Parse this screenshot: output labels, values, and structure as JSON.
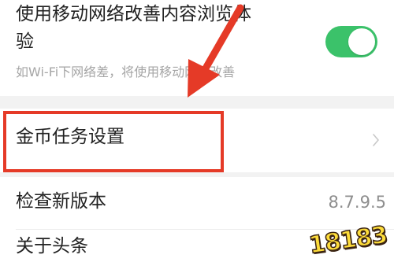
{
  "settings": {
    "mobile_improve": {
      "title_line1": "使用移动网络改善内容浏览体",
      "title_line2": "验",
      "subtitle": "如Wi-Fi下网络差，将使用移动网络改善",
      "toggle_on": true,
      "toggle_color": "#3bc26a"
    },
    "coin_task": {
      "label": "金币任务设置"
    },
    "check_update": {
      "label": "检查新版本",
      "version": "8.7.9.5"
    },
    "about": {
      "label": "关于头条"
    }
  },
  "annotation": {
    "highlight_color": "#e53a27",
    "arrow_color": "#e53a27"
  },
  "watermark": {
    "text": "18183",
    "icon": "18183-logo"
  }
}
